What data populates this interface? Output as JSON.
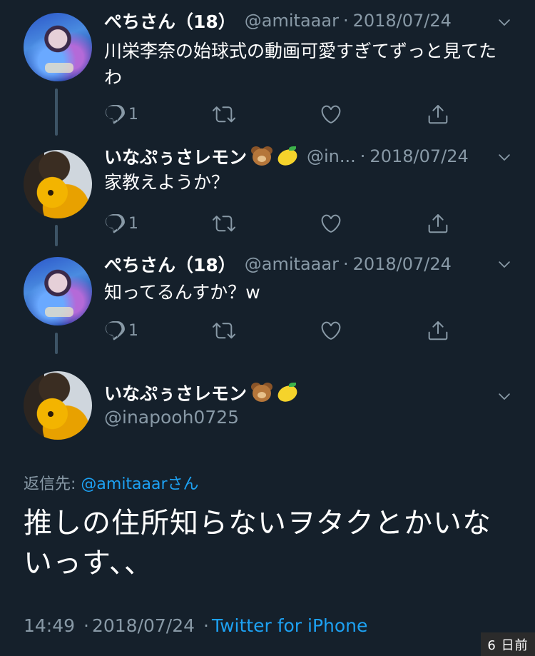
{
  "replies": [
    {
      "display_name": "ぺちさん（18）",
      "handle": "@amitaaar",
      "sep": "·",
      "date": "2018/07/24",
      "text": "川栄李奈の始球式の動画可愛すぎてずっと見てたわ",
      "reply_count": "1",
      "emoji": []
    },
    {
      "display_name": "いなぷぅさレモン",
      "handle": "@in...",
      "sep": "·",
      "date": "2018/07/24",
      "text": "家教えようか？",
      "reply_count": "1",
      "emoji": [
        "bear-emoji",
        "lemon-emoji"
      ]
    },
    {
      "display_name": "ぺちさん（18）",
      "handle": "@amitaaar",
      "sep": "·",
      "date": "2018/07/24",
      "text": "知ってるんすか？w",
      "reply_count": "1",
      "emoji": []
    }
  ],
  "main_tweet": {
    "display_name": "いなぷぅさレモン",
    "handle": "@inapooh0725",
    "emoji": [
      "bear-emoji",
      "lemon-emoji"
    ],
    "reply_to_label": "返信先: ",
    "reply_to_mention": "@amitaaar",
    "reply_to_suffix": "さん",
    "text": "推しの住所知らないヲタクとかいないっす、、",
    "time": "14:49",
    "sep": "·",
    "date": "2018/07/24",
    "source": "Twitter for iPhone"
  },
  "badge": "6 日前",
  "icons": {
    "reply": "reply-icon",
    "retweet": "retweet-icon",
    "like": "heart-icon",
    "share": "share-icon",
    "more": "chevron-down-icon"
  },
  "colors": {
    "background": "#15202b",
    "secondary_text": "#8899a6",
    "link": "#1da1f2",
    "thread_line": "#3d5466"
  }
}
